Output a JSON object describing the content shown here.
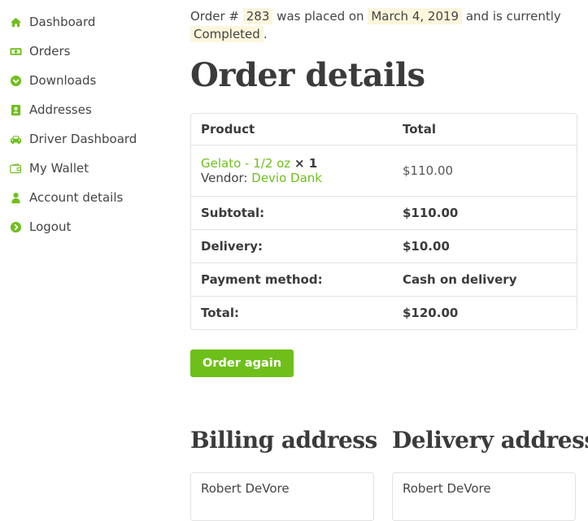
{
  "sidebar": {
    "items": [
      {
        "label": "Dashboard",
        "icon": "home-icon"
      },
      {
        "label": "Orders",
        "icon": "money-icon"
      },
      {
        "label": "Downloads",
        "icon": "download-circle-icon"
      },
      {
        "label": "Addresses",
        "icon": "address-book-icon"
      },
      {
        "label": "Driver Dashboard",
        "icon": "car-icon"
      },
      {
        "label": "My Wallet",
        "icon": "wallet-icon"
      },
      {
        "label": "Account details",
        "icon": "user-icon"
      },
      {
        "label": "Logout",
        "icon": "logout-circle-icon"
      }
    ],
    "accent_color": "#6fbf1a"
  },
  "status": {
    "prefix": "Order #",
    "order_number": "283",
    "mid": "was placed on",
    "date": "March 4, 2019",
    "suffix": "and is currently",
    "state": "Completed",
    "end": "."
  },
  "title": "Order details",
  "table": {
    "headers": {
      "product": "Product",
      "total": "Total"
    },
    "item": {
      "name": "Gelato - 1/2 oz",
      "qty": "× 1",
      "vendor_label": "Vendor:",
      "vendor_name": "Devio Dank",
      "total": "$110.00"
    },
    "rows": [
      {
        "label": "Subtotal:",
        "value": "$110.00"
      },
      {
        "label": "Delivery:",
        "value": "$10.00"
      },
      {
        "label": "Payment method:",
        "value": "Cash on delivery"
      },
      {
        "label": "Total:",
        "value": "$120.00"
      }
    ]
  },
  "order_again_label": "Order again",
  "billing": {
    "title": "Billing address",
    "name": "Robert DeVore"
  },
  "delivery": {
    "title": "Delivery address",
    "name": "Robert DeVore"
  }
}
